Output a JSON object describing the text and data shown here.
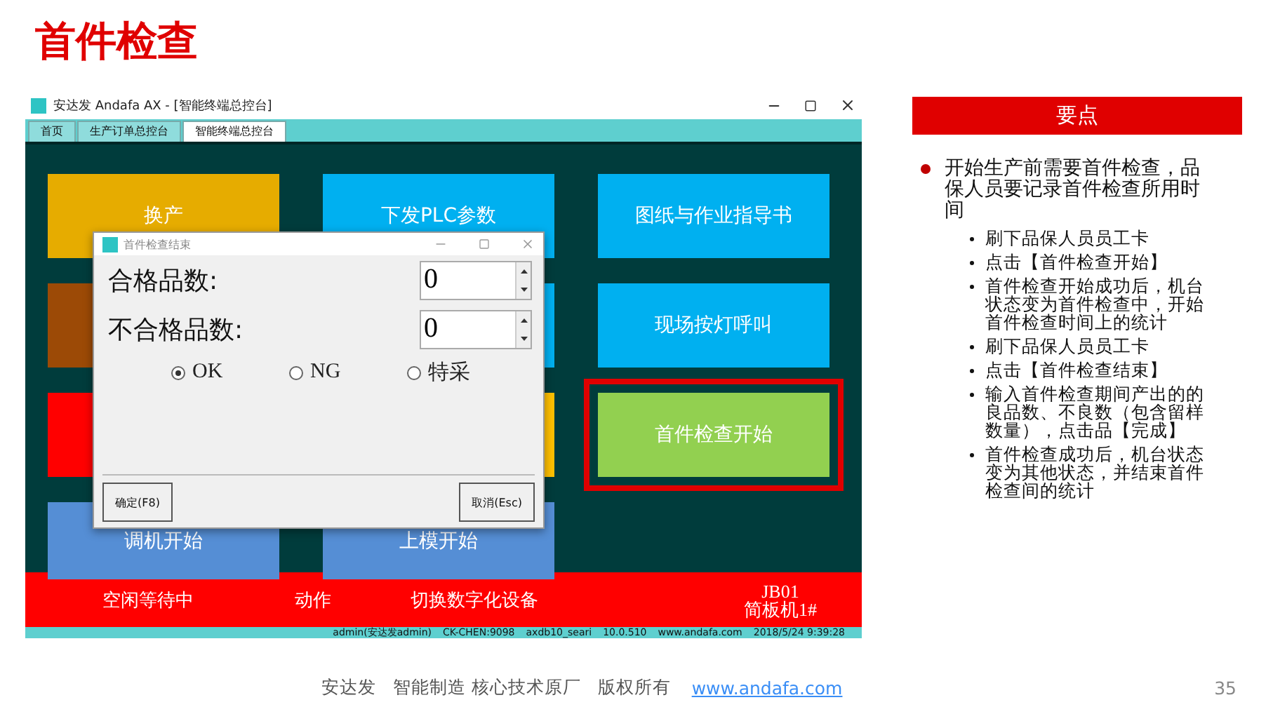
{
  "slide_title": "首件检查",
  "app": {
    "title": "安达发 Andafa AX - [智能终端总控台]",
    "tabs": [
      {
        "label": "首页",
        "selected": false
      },
      {
        "label": "生产订单总控台",
        "selected": false
      },
      {
        "label": "智能终端总控台",
        "selected": true
      }
    ],
    "tiles": [
      {
        "label": "换产",
        "color": "#e6ac00",
        "highlighted": false
      },
      {
        "label": "下发PLC参数",
        "color": "#00b0f0",
        "highlighted": false
      },
      {
        "label": "图纸与作业指导书",
        "color": "#00b0f0",
        "highlighted": false
      },
      {
        "color": "#9c4a06",
        "highlighted": false
      },
      {
        "color": "#00b0f0",
        "highlighted": false
      },
      {
        "label": "现场按灯呼叫",
        "color": "#00b0f0",
        "highlighted": false
      },
      {
        "color": "#ff0000",
        "highlighted": false
      },
      {
        "color": "#ffc000",
        "highlighted": false
      },
      {
        "label": "首件检查开始",
        "color": "#92d050",
        "highlighted": true
      },
      {
        "label": "调机开始",
        "color": "#558ed5",
        "highlighted": false
      },
      {
        "label": "上模开始",
        "color": "#558ed5",
        "highlighted": false
      }
    ],
    "status_bar": {
      "state": "空闲等待中",
      "action": "动作",
      "switch": "切换数字化设备",
      "machine_code": "JB01",
      "machine_name": "简板机1#"
    },
    "info_bar": [
      "admin(安达发admin)",
      "CK-CHEN:9098",
      "axdb10_seari",
      "10.0.510",
      "www.andafa.com",
      "2018/5/24 9:39:28"
    ],
    "dialog": {
      "title": "首件检查结束",
      "fields": [
        {
          "label": "合格品数:",
          "value": "0"
        },
        {
          "label": "不合格品数:",
          "value": "0"
        }
      ],
      "options": [
        {
          "label": "OK",
          "selected": true
        },
        {
          "label": "NG",
          "selected": false
        },
        {
          "label": "特采",
          "selected": false
        }
      ],
      "confirm": "确定(F8)",
      "cancel": "取消(Esc)"
    }
  },
  "panel": {
    "title": "要点",
    "point": "开始生产前需要首件检查，品保人员要记录首件检查所用时间",
    "steps": [
      "刷下品保人员员工卡",
      "点击【首件检查开始】",
      "首件检查开始成功后，机台状态变为首件检查中，开始首件检查时间上的统计",
      "刷下品保人员员工卡",
      "点击【首件检查结束】",
      "输入首件检查期间产出的的良品数、不良数（包含留样数量），点击品【完成】",
      "首件检查成功后，机台状态变为其他状态，并结束首件检查间的统计"
    ]
  },
  "footer": {
    "text": "安达发   智能制造 核心技术原厂   版权所有",
    "link": "www.andafa.com",
    "page": "35"
  }
}
